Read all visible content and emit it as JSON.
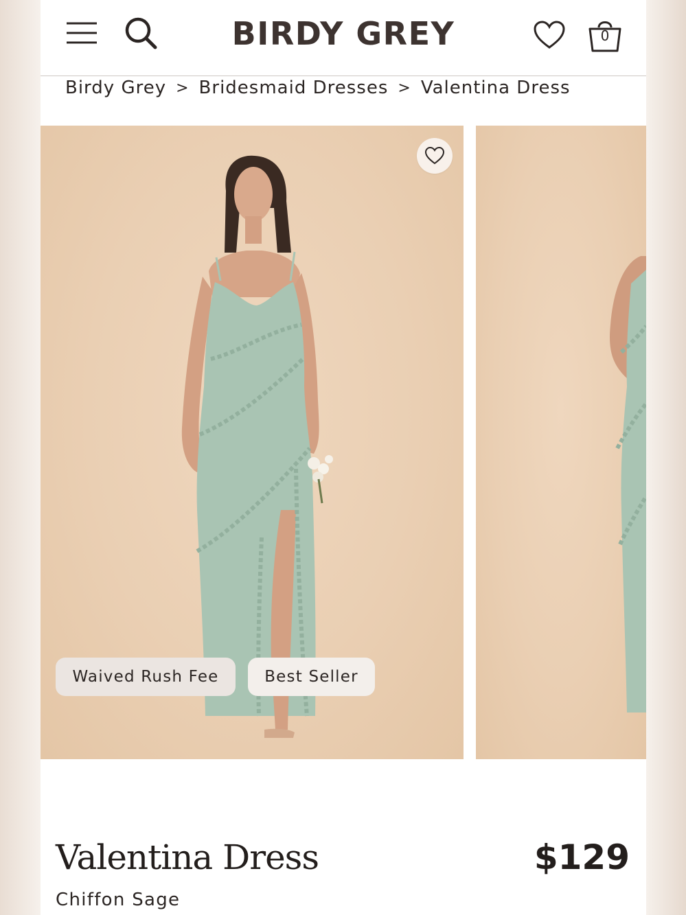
{
  "header": {
    "brand": "BIRDY GREY",
    "bag_count": "0"
  },
  "breadcrumb": [
    "Birdy Grey",
    "Bridesmaid Dresses",
    "Valentina Dress"
  ],
  "breadcrumb_separator": ">",
  "icons": {
    "menu": "hamburger-menu-icon",
    "search": "search-icon",
    "wishlist": "heart-icon",
    "bag": "shopping-bag-icon",
    "favorite": "heart-icon"
  },
  "product": {
    "badges": [
      "Waived Rush Fee",
      "Best Seller"
    ],
    "name": "Valentina Dress",
    "price": "$129",
    "variant": "Chiffon Sage"
  },
  "colors": {
    "dress": "#a9c4b3",
    "backdrop": "#ebd0b4",
    "text": "#2b2523",
    "brand": "#3d3330"
  }
}
